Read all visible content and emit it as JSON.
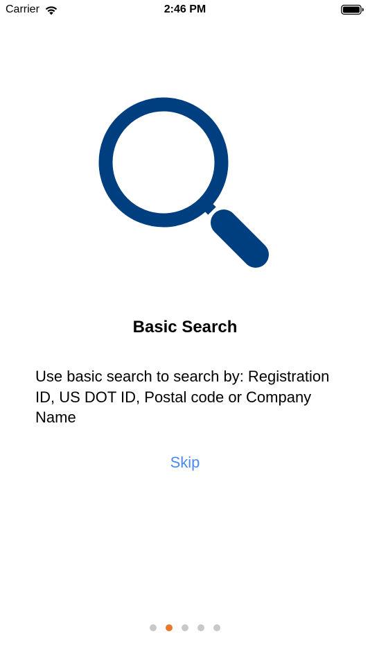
{
  "status_bar": {
    "carrier": "Carrier",
    "time": "2:46 PM",
    "wifi_icon": "wifi-icon",
    "battery_icon": "battery-full-icon"
  },
  "onboarding": {
    "icon": "magnifying-glass-icon",
    "icon_color": "#003f7f",
    "title": "Basic Search",
    "description": "Use basic search to search by: Registration ID, US DOT ID, Postal code or Company Name",
    "skip_label": "Skip",
    "skip_color": "#4a89f3"
  },
  "page_indicator": {
    "total_pages": 5,
    "current_page": 2,
    "active_color": "#e8792b",
    "inactive_color": "#c7c7cc"
  }
}
